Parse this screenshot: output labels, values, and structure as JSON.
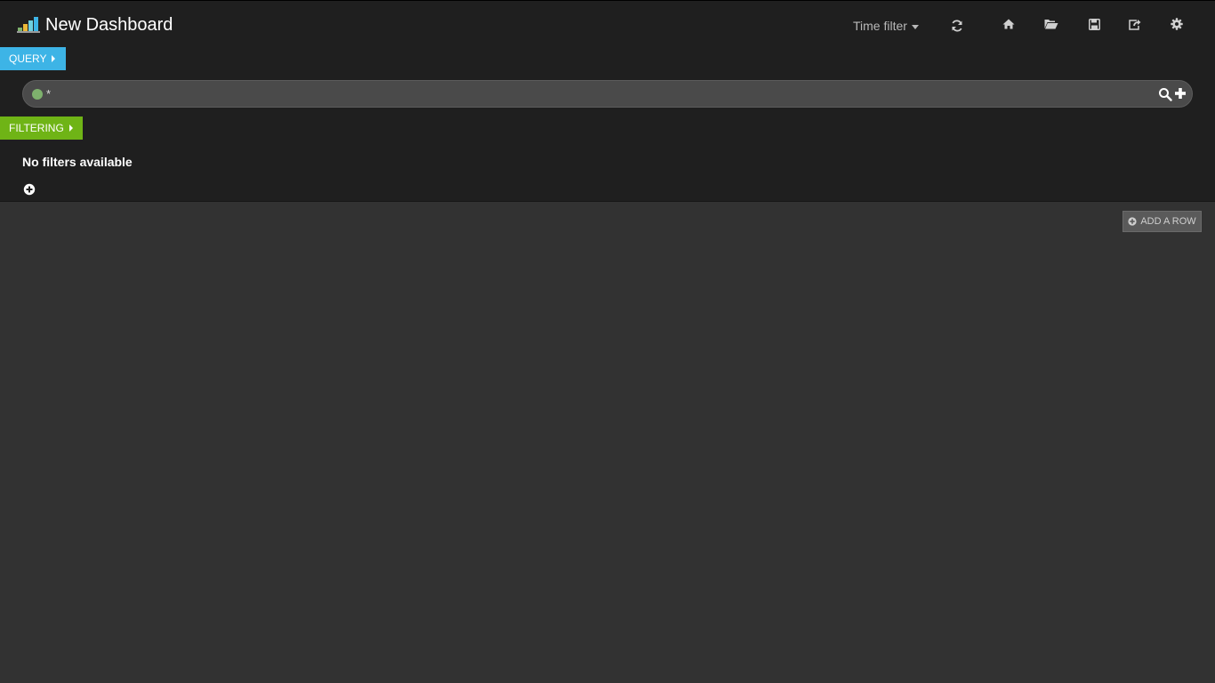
{
  "navbar": {
    "title": "New Dashboard",
    "time_filter_label": "Time filter",
    "icons": [
      "refresh-icon",
      "home-icon",
      "folder-open-icon",
      "save-icon",
      "share-icon",
      "gear-icon"
    ]
  },
  "query": {
    "tab_label": "QUERY",
    "value": "*",
    "series_color": "#7eb26d"
  },
  "filtering": {
    "tab_label": "FILTERING",
    "empty_message": "No filters available"
  },
  "rows": {
    "add_row_label": "ADD A ROW"
  },
  "colors": {
    "query_accent": "#3db4e6",
    "filter_accent": "#6fb416",
    "panel_bg": "#1f1f1f",
    "body_bg": "#323232"
  }
}
